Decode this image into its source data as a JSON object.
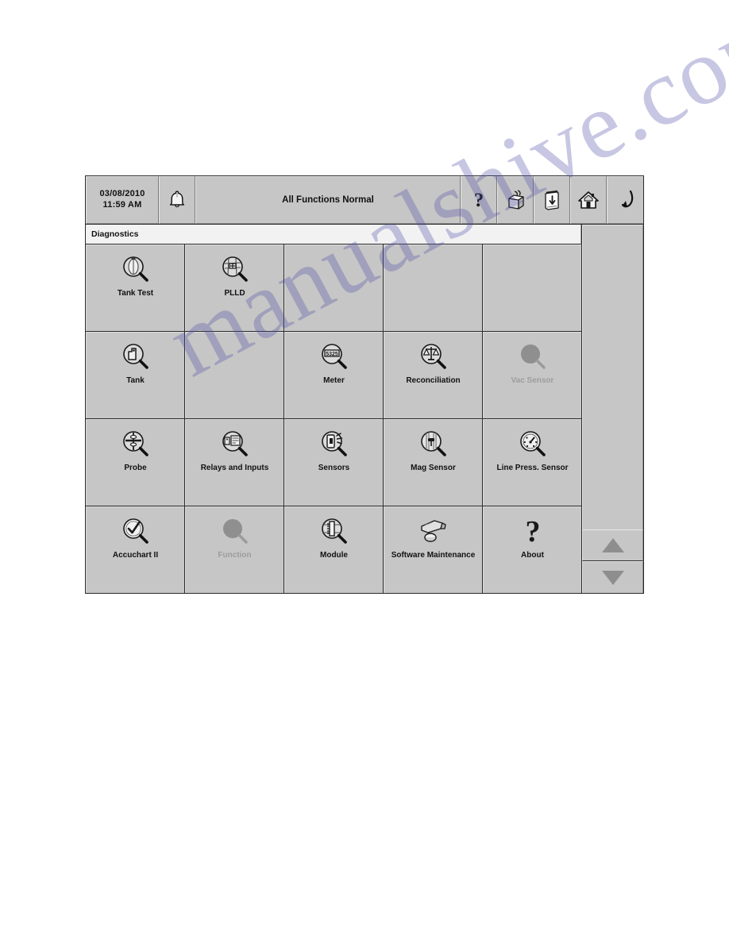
{
  "statusbar": {
    "date": "03/08/2010",
    "time": "11:59 AM",
    "alarm_icon": "bell-icon",
    "status_text": "All Functions Normal",
    "buttons": [
      {
        "name": "help-button",
        "icon": "question-mark-icon",
        "label": "Help"
      },
      {
        "name": "print-button",
        "icon": "printer-icon",
        "label": "Print"
      },
      {
        "name": "report-button",
        "icon": "report-paper-icon",
        "label": "Report"
      },
      {
        "name": "home-button",
        "icon": "home-icon",
        "label": "Home"
      },
      {
        "name": "enter-button",
        "icon": "return-arrow-icon",
        "label": "Enter"
      }
    ]
  },
  "section": {
    "title": "Diagnostics"
  },
  "grid": {
    "columns": 5,
    "rows": 4,
    "cells": [
      {
        "label": "Tank Test",
        "icon": "tank-test-magnifier-icon",
        "enabled": true,
        "empty": false
      },
      {
        "label": "PLLD",
        "icon": "plld-magnifier-icon",
        "enabled": true,
        "empty": false
      },
      {
        "label": "",
        "icon": "",
        "enabled": false,
        "empty": true
      },
      {
        "label": "",
        "icon": "",
        "enabled": false,
        "empty": true
      },
      {
        "label": "",
        "icon": "",
        "enabled": false,
        "empty": true
      },
      {
        "label": "Tank",
        "icon": "tank-magnifier-icon",
        "enabled": true,
        "empty": false
      },
      {
        "label": "",
        "icon": "",
        "enabled": false,
        "empty": true
      },
      {
        "label": "Meter",
        "icon": "meter-magnifier-icon",
        "enabled": true,
        "empty": false
      },
      {
        "label": "Reconciliation",
        "icon": "scales-magnifier-icon",
        "enabled": true,
        "empty": false
      },
      {
        "label": "Vac Sensor",
        "icon": "blank-magnifier-icon",
        "enabled": false,
        "empty": false
      },
      {
        "label": "Probe",
        "icon": "probe-magnifier-icon",
        "enabled": true,
        "empty": false
      },
      {
        "label": "Relays and Inputs",
        "icon": "relays-magnifier-icon",
        "enabled": true,
        "empty": false
      },
      {
        "label": "Sensors",
        "icon": "sensors-magnifier-icon",
        "enabled": true,
        "empty": false
      },
      {
        "label": "Mag Sensor",
        "icon": "mag-sensor-magnifier-icon",
        "enabled": true,
        "empty": false
      },
      {
        "label": "Line Press. Sensor",
        "icon": "gauge-magnifier-icon",
        "enabled": true,
        "empty": false
      },
      {
        "label": "Accuchart II",
        "icon": "check-magnifier-icon",
        "enabled": true,
        "empty": false
      },
      {
        "label": "Function",
        "icon": "blank-magnifier-icon",
        "enabled": false,
        "empty": false
      },
      {
        "label": "Module",
        "icon": "module-magnifier-icon",
        "enabled": true,
        "empty": false
      },
      {
        "label": "Software Maintenance",
        "icon": "usb-key-icon",
        "enabled": true,
        "empty": false
      },
      {
        "label": "About",
        "icon": "question-mark-icon",
        "enabled": true,
        "empty": false
      }
    ],
    "meter_display_value": "5325"
  },
  "scrollbar": {
    "up_arrow": "triangle-up-icon",
    "down_arrow": "triangle-down-icon"
  },
  "colors": {
    "panel_bg": "#c6c6c6",
    "border": "#2a2a2a",
    "title_bg": "#f2f2f2",
    "text": "#111111",
    "disabled_text": "#9d9d9d",
    "watermark": "#4a4aa8"
  },
  "watermark": {
    "text": "manualshive.com"
  }
}
